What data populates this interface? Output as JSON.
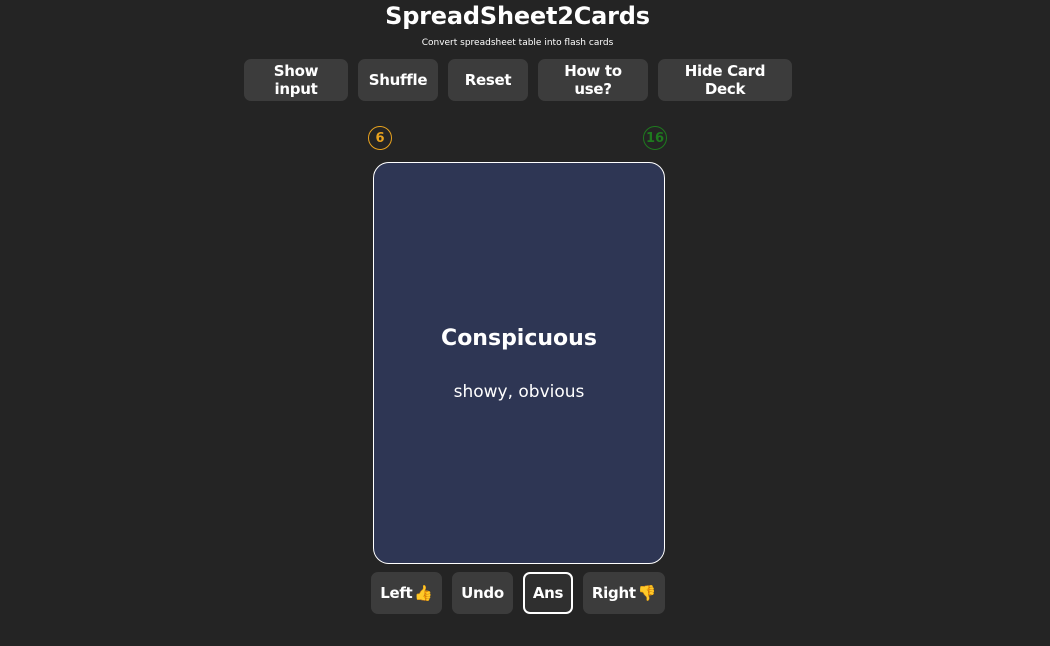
{
  "header": {
    "title": "SpreadSheet2Cards",
    "subtitle": "Convert spreadsheet table into flash cards"
  },
  "toolbar": {
    "show_input": "Show input",
    "shuffle": "Shuffle",
    "reset": "Reset",
    "how_to_use": "How to use?",
    "hide_deck": "Hide Card Deck"
  },
  "counters": {
    "left": "6",
    "right": "16",
    "left_color": "#e8a21e",
    "right_color": "#1e7a1e"
  },
  "card": {
    "front": "Conspicuous",
    "back": "showy, obvious",
    "background": "#2e3654"
  },
  "controls": {
    "left": "Left",
    "left_icon": "👍",
    "undo": "Undo",
    "ans": "Ans",
    "right": "Right",
    "right_icon": "👎"
  }
}
